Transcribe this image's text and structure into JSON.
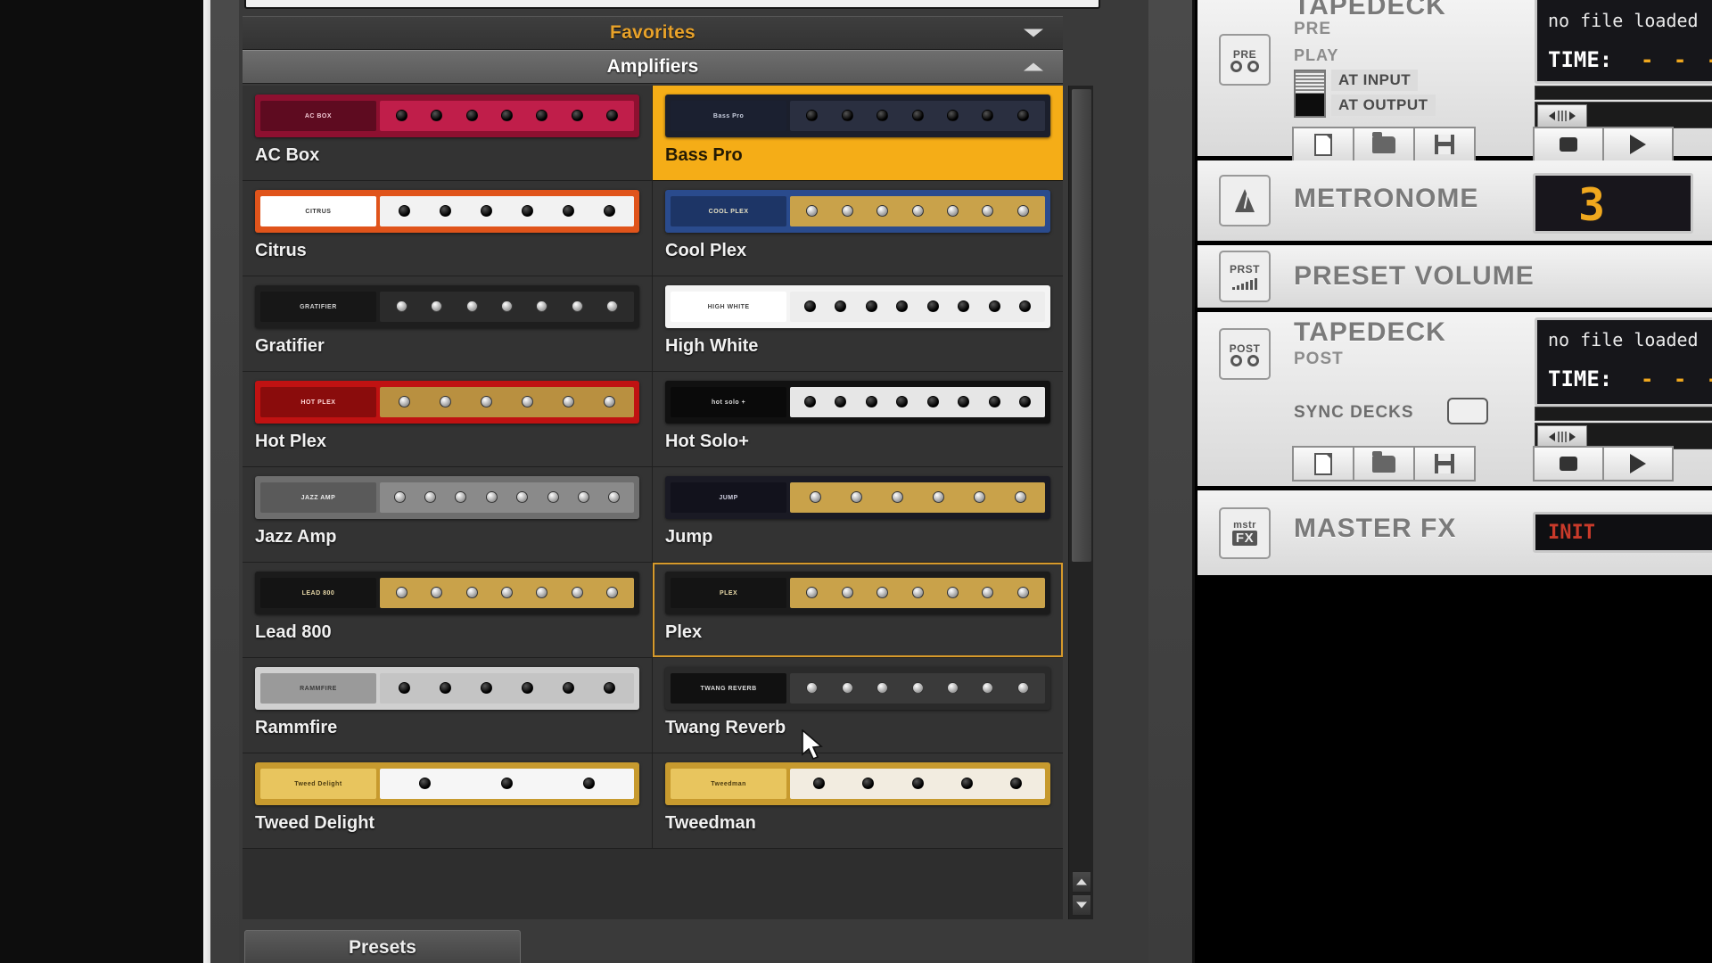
{
  "browser": {
    "search_value": "",
    "favorites_header": "Favorites",
    "category_header": "Amplifiers",
    "presets_button": "Presets",
    "amps": [
      {
        "name": "AC Box",
        "badge": "AC BOX",
        "style": "acbox",
        "selected": "none"
      },
      {
        "name": "Bass Pro",
        "badge": "Bass Pro",
        "style": "basspro",
        "selected": "fill"
      },
      {
        "name": "Citrus",
        "badge": "CITRUS",
        "style": "citrus",
        "selected": "none"
      },
      {
        "name": "Cool Plex",
        "badge": "COOL PLEX",
        "style": "coolplex",
        "selected": "none"
      },
      {
        "name": "Gratifier",
        "badge": "GRATIFIER",
        "style": "gratifier",
        "selected": "none"
      },
      {
        "name": "High White",
        "badge": "HIGH WHITE",
        "style": "highwhite",
        "selected": "none"
      },
      {
        "name": "Hot Plex",
        "badge": "HOT PLEX",
        "style": "hotplex",
        "selected": "none"
      },
      {
        "name": "Hot Solo+",
        "badge": "hot solo +",
        "style": "hotsolo",
        "selected": "none"
      },
      {
        "name": "Jazz Amp",
        "badge": "JAZZ AMP",
        "style": "jazzamp",
        "selected": "none"
      },
      {
        "name": "Jump",
        "badge": "JUMP",
        "style": "jump",
        "selected": "none"
      },
      {
        "name": "Lead 800",
        "badge": "LEAD 800",
        "style": "lead800",
        "selected": "none"
      },
      {
        "name": "Plex",
        "badge": "PLEX",
        "style": "plex",
        "selected": "outline"
      },
      {
        "name": "Rammfire",
        "badge": "RAMMFIRE",
        "style": "rammfire",
        "selected": "none"
      },
      {
        "name": "Twang Reverb",
        "badge": "TWANG REVERB",
        "style": "twang",
        "selected": "none"
      },
      {
        "name": "Tweed Delight",
        "badge": "Tweed Delight",
        "style": "tweeddelight",
        "selected": "none"
      },
      {
        "name": "Tweedman",
        "badge": "Tweedman",
        "style": "tweedman",
        "selected": "none"
      }
    ]
  },
  "rack": {
    "tapedeck_pre": {
      "icon": "PRE",
      "title": "TAPEDECK",
      "subtitle": "PRE",
      "play_label": "PLAY",
      "at_input": "AT INPUT",
      "at_output": "AT OUTPUT",
      "file_status": "no file loaded",
      "time_label": "TIME:",
      "time_value": "- - -"
    },
    "metronome": {
      "title": "METRONOME",
      "value": "3"
    },
    "preset_volume": {
      "icon": "PRST",
      "title": "PRESET VOLUME"
    },
    "tapedeck_post": {
      "icon": "POST",
      "title": "TAPEDECK",
      "subtitle": "POST",
      "sync_label": "SYNC DECKS",
      "file_status": "no file loaded",
      "time_label": "TIME:",
      "time_value": "- - -"
    },
    "master_fx": {
      "icon_top": "mstr",
      "icon_bottom": "FX",
      "title": "MASTER FX",
      "preset_value": "INIT"
    }
  },
  "colors": {
    "accent_orange": "#e8a22a",
    "selection_fill": "#f5ad17",
    "selection_outline": "#d79a2b",
    "lcd_amber": "#f0a81e",
    "lcd_red": "#c93a2a",
    "panel_dark": "#333333"
  }
}
